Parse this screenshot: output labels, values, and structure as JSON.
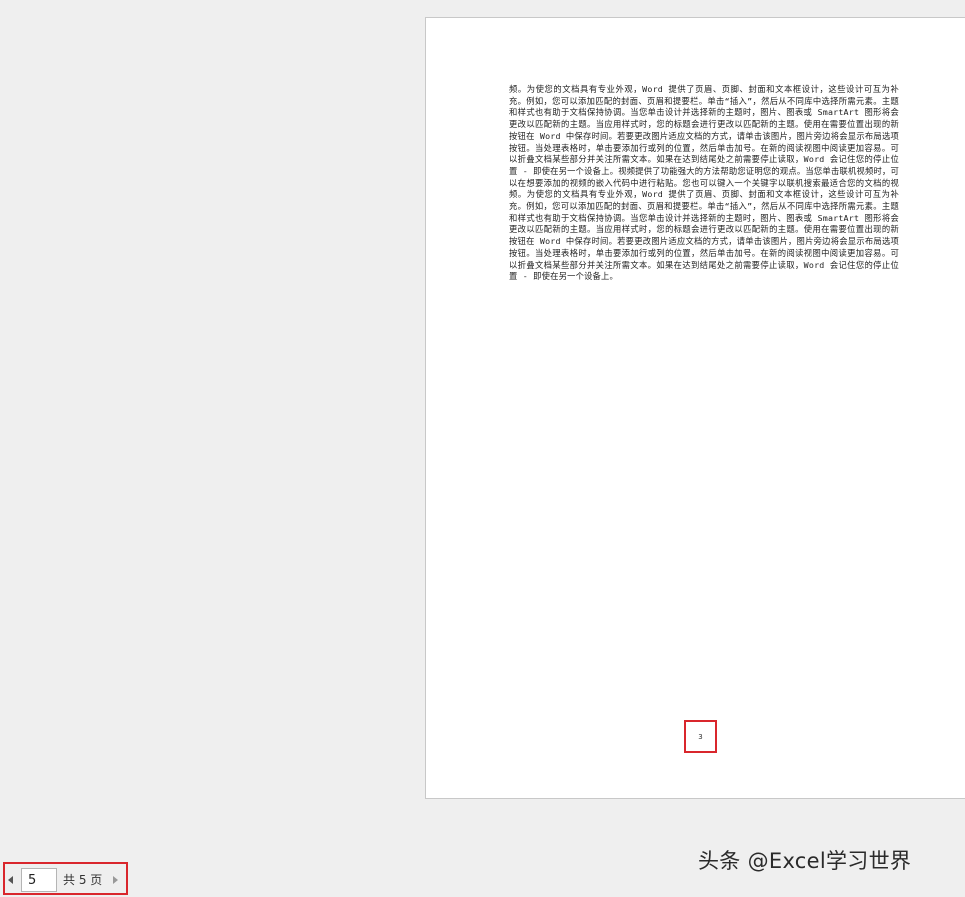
{
  "document": {
    "body_text": "频。为使您的文档具有专业外观，Word 提供了页眉、页脚、封面和文本框设计，这些设计可互为补充。例如，您可以添加匹配的封面、页眉和提要栏。单击“插入”，然后从不同库中选择所需元素。主题和样式也有助于文档保持协调。当您单击设计并选择新的主题时，图片、图表或 SmartArt 图形将会更改以匹配新的主题。当应用样式时，您的标题会进行更改以匹配新的主题。使用在需要位置出现的新按钮在 Word 中保存时间。若要更改图片适应文档的方式，请单击该图片，图片旁边将会显示布局选项按钮。当处理表格时，单击要添加行或列的位置，然后单击加号。在新的阅读视图中阅读更加容易。可以折叠文档某些部分并关注所需文本。如果在达到结尾处之前需要停止读取，Word 会记住您的停止位置 - 即使在另一个设备上。视频提供了功能强大的方法帮助您证明您的观点。当您单击联机视频时，可以在想要添加的视频的嵌入代码中进行粘贴。您也可以键入一个关键字以联机搜索最适合您的文档的视频。为使您的文档具有专业外观，Word 提供了页眉、页脚、封面和文本框设计，这些设计可互为补充。例如，您可以添加匹配的封面、页眉和提要栏。单击“插入”，然后从不同库中选择所需元素。主题和样式也有助于文档保持协调。当您单击设计并选择新的主题时，图片、图表或 SmartArt 图形将会更改以匹配新的主题。当应用样式时，您的标题会进行更改以匹配新的主题。使用在需要位置出现的新按钮在 Word 中保存时间。若要更改图片适应文档的方式，请单击该图片，图片旁边将会显示布局选项按钮。当处理表格时，单击要添加行或列的位置，然后单击加号。在新的阅读视图中阅读更加容易。可以折叠文档某些部分并关注所需文本。如果在达到结尾处之前需要停止读取，Word 会记住您的停止位置 - 即使在另一个设备上。",
    "page_number": "3"
  },
  "navigation": {
    "prev_icon": "triangle-left-icon",
    "current_page": "5",
    "total_label": "共 5 页",
    "next_icon": "triangle-right-icon"
  },
  "watermark": {
    "text": "头条 @Excel学习世界"
  },
  "colors": {
    "highlight_border": "#d9262c",
    "workspace_background": "#efefef",
    "page_background": "#ffffff"
  }
}
